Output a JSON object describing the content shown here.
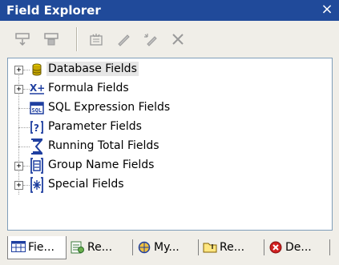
{
  "window": {
    "title": "Field Explorer",
    "close_glyph": "×"
  },
  "toolbar": {
    "buttons": [
      {
        "icon": "insert-to-report-icon",
        "enabled": false
      },
      {
        "icon": "browse-data-icon",
        "enabled": false
      },
      {
        "icon": "new-field-icon",
        "enabled": false
      },
      {
        "icon": "edit-pencil-icon",
        "enabled": false
      },
      {
        "icon": "rename-icon",
        "enabled": false
      },
      {
        "icon": "delete-x-icon",
        "enabled": false
      }
    ]
  },
  "tree": {
    "items": [
      {
        "label": "Database Fields",
        "icon": "database-icon",
        "expandable": true,
        "selected": true
      },
      {
        "label": "Formula Fields",
        "icon": "formula-icon",
        "expandable": true,
        "selected": false
      },
      {
        "label": "SQL Expression Fields",
        "icon": "sql-expression-icon",
        "expandable": false,
        "selected": false
      },
      {
        "label": "Parameter Fields",
        "icon": "parameter-icon",
        "expandable": false,
        "selected": false
      },
      {
        "label": "Running Total Fields",
        "icon": "sigma-icon",
        "expandable": false,
        "selected": false
      },
      {
        "label": "Group Name Fields",
        "icon": "group-name-icon",
        "expandable": true,
        "selected": false
      },
      {
        "label": "Special Fields",
        "icon": "special-fields-icon",
        "expandable": true,
        "selected": false
      }
    ],
    "expand_glyph": "+"
  },
  "tabs": [
    {
      "label": "Fie...",
      "icon": "field-explorer-tab-icon",
      "active": true
    },
    {
      "label": "Re...",
      "icon": "report-explorer-tab-icon",
      "active": false
    },
    {
      "label": "My...",
      "icon": "repository-tab-icon",
      "active": false
    },
    {
      "label": "Re...",
      "icon": "report-folder-tab-icon",
      "active": false
    },
    {
      "label": "De...",
      "icon": "dependency-checker-tab-icon",
      "active": false
    }
  ],
  "colors": {
    "titlebar": "#204a9a",
    "selection": "#e6e6e6",
    "tree_border": "#7f9db9",
    "icon_blue": "#1f3fa0"
  }
}
